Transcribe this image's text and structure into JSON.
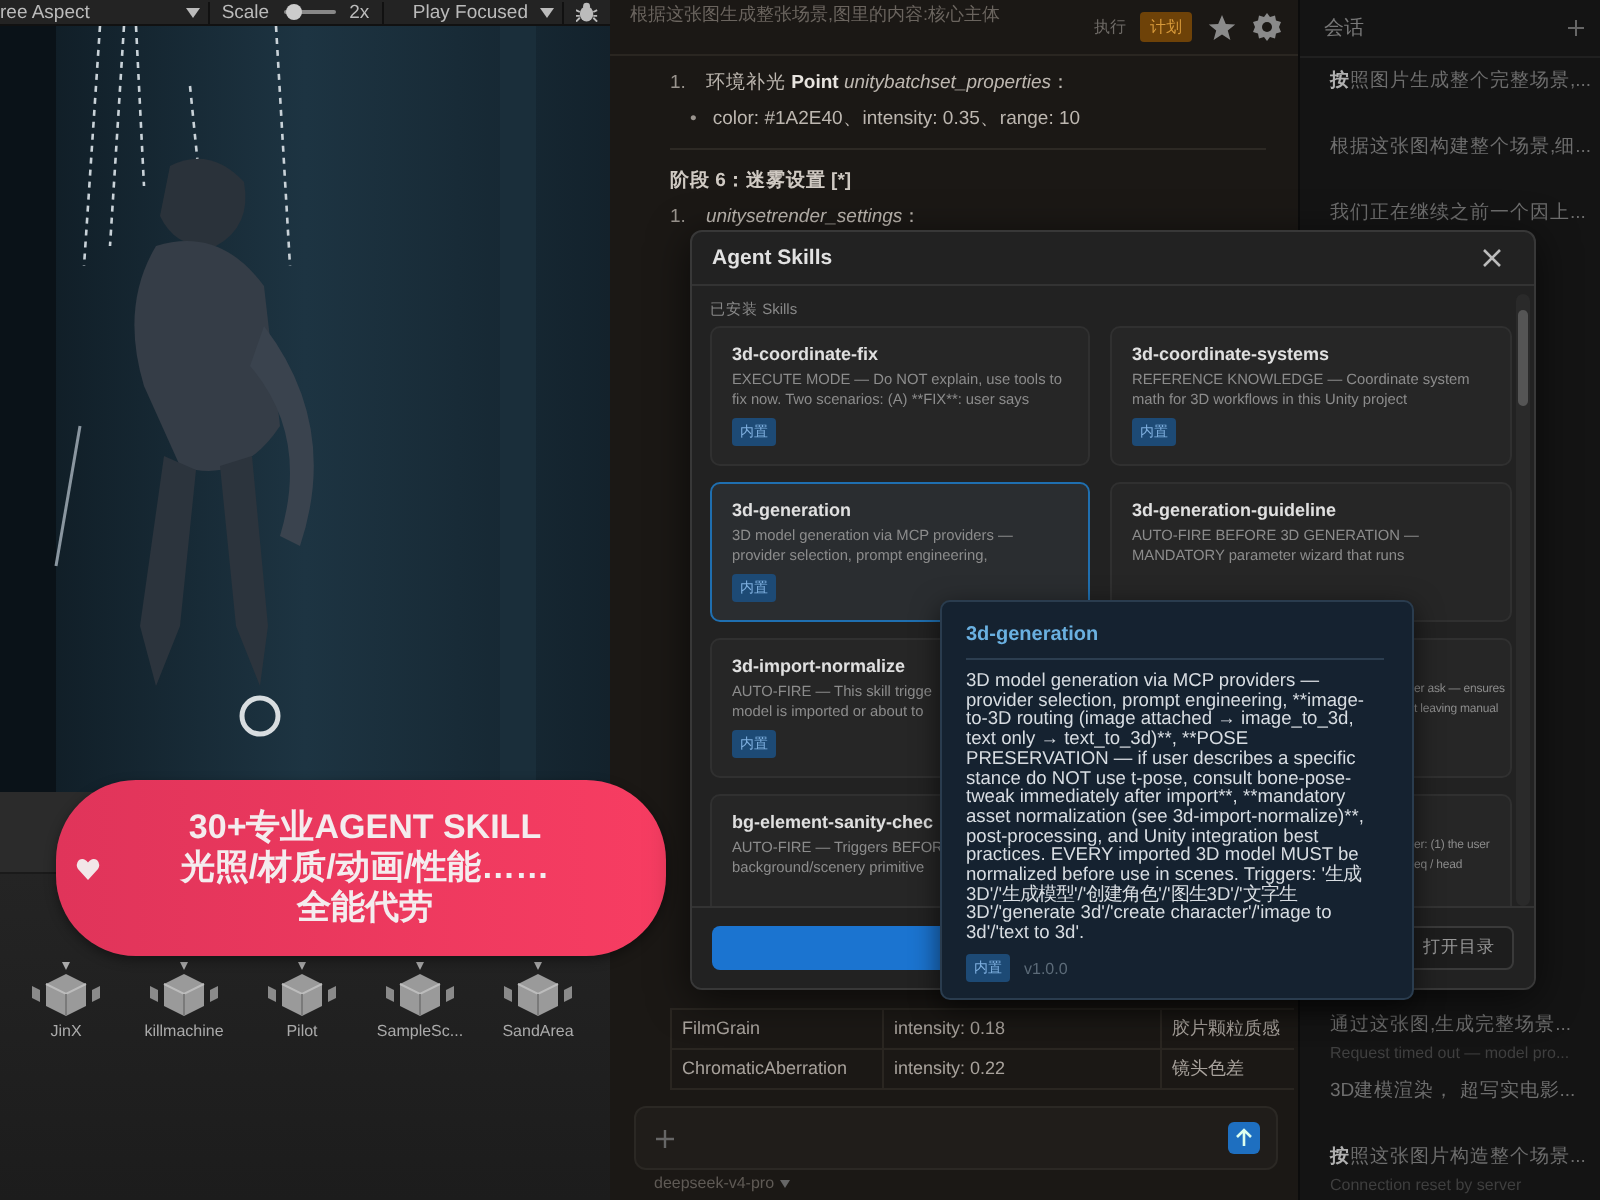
{
  "game_view": {
    "toolbar": {
      "aspect": "ree Aspect",
      "scale_label": "Scale",
      "scale": {
        "level": 0.12
      },
      "scale_value": "2x",
      "play_mode": "Play Focused"
    }
  },
  "project_assets": [
    {
      "name": "JinX"
    },
    {
      "name": "killmachine"
    },
    {
      "name": "Pilot"
    },
    {
      "name": "SampleSc..."
    },
    {
      "name": "SandArea"
    }
  ],
  "promo_banner": {
    "lines": [
      "30+专业AGENT SKILL",
      "光照/材质/动画/性能……",
      "全能代劳"
    ]
  },
  "chat": {
    "title": "根据这张图生成整张场景,图里的内容:核心主体",
    "modes": [
      {
        "label": "执行",
        "selected": false
      },
      {
        "label": "计划",
        "selected": true
      }
    ],
    "content": [
      {
        "kind": "numbered",
        "marker": "1.",
        "text": "环境补光 **Point** *unitybatchset_properties*："
      },
      {
        "kind": "bullet",
        "marker": "•",
        "text": "color: #1A2E40、intensity: 0.35、range: 10"
      },
      {
        "kind": "divider"
      },
      {
        "kind": "heading",
        "text": "阶段 6：迷雾设置 [*]"
      },
      {
        "kind": "numbered",
        "marker": "1.",
        "text": "*unitysetrender_settings*："
      }
    ],
    "table": {
      "rows": [
        [
          "FilmGrain",
          "intensity: 0.18",
          "胶片颗粒质感"
        ],
        [
          "ChromaticAberration",
          "intensity: 0.22",
          "镜头色差"
        ]
      ]
    },
    "model": "deepseek-v4-pro"
  },
  "sessions": {
    "title": "会话",
    "top": [
      {
        "title": "**按**照图片生成整个完整场景,..."
      },
      {
        "title": "根据这张图构建整个场景,细..."
      },
      {
        "title": "我们正在继续之前一个因上..."
      }
    ],
    "bottom": [
      {
        "title": "通过这张图,生成完整场景...",
        "subtitle": "Request timed out — model pro..."
      },
      {
        "title": "3D建模渲染， 超写实电影..."
      },
      {
        "title": "**按**照这张图片构造整个场景...",
        "subtitle": "Connection reset by server"
      }
    ]
  },
  "modal": {
    "title": "Agent Skills",
    "section": "已安装 Skills",
    "skills": [
      {
        "name": "3d-coordinate-fix",
        "lines": [
          "EXECUTE MODE — Do NOT explain, use tools to",
          "fix now. Two scenarios: (A) **FIX**: user says"
        ],
        "badge": "内置",
        "selected": false,
        "kind": "full"
      },
      {
        "name": "3d-coordinate-systems",
        "lines": [
          "REFERENCE KNOWLEDGE — Coordinate system",
          "math for 3D workflows in this Unity project"
        ],
        "badge": "内置",
        "selected": false,
        "kind": "full"
      },
      {
        "name": "3d-generation",
        "lines": [
          "3D model generation via MCP providers —",
          "provider selection, prompt engineering,"
        ],
        "badge": "内置",
        "selected": true,
        "kind": "full"
      },
      {
        "name": "3d-generation-guideline",
        "lines": [
          "AUTO-FIRE BEFORE 3D GENERATION —",
          "MANDATORY parameter wizard that runs"
        ],
        "selected": false,
        "kind": "full"
      },
      {
        "name": "3d-import-normalize",
        "lines": [
          "AUTO-FIRE — This skill trigge",
          "model is imported or about to"
        ],
        "badge": "内置",
        "selected": false,
        "kind": "full"
      },
      {
        "lines": [
          "er ask — ensures",
          "t leaving manual"
        ],
        "selected": false,
        "kind": "partial"
      },
      {
        "name": "bg-element-sanity-chec",
        "lines": [
          "AUTO-FIRE — Triggers BEFOR",
          "background/scenery primitive"
        ],
        "selected": false,
        "kind": "full"
      },
      {
        "lines": [
          "er: (1) the user",
          "eq / head"
        ],
        "selected": false,
        "kind": "partial"
      }
    ],
    "buttons": [
      {
        "kind": "primary"
      },
      {
        "kind": "secondary",
        "label": "打开目录"
      }
    ]
  },
  "tooltip": {
    "title": "3d-generation",
    "text": "3D model generation via MCP providers — provider selection, prompt engineering, **image-to-3D routing (image attached → image_to_3d, text only → text_to_3d)**, **POSE PRESERVATION — if user describes a specific stance do NOT use t-pose, consult bone-pose-tweak immediately after import**, **mandatory asset normalization (see 3d-import-normalize)**, post-processing, and Unity integration best practices. EVERY imported 3D model MUST be normalized before use in scenes. Triggers: '生成3D'/'生成模型'/'创建角色'/'图生3D'/'文字生3D'/'generate 3d'/'create character'/'image to 3d'/'text to 3d'.",
    "badge": "内置",
    "version": "v1.0.0"
  }
}
